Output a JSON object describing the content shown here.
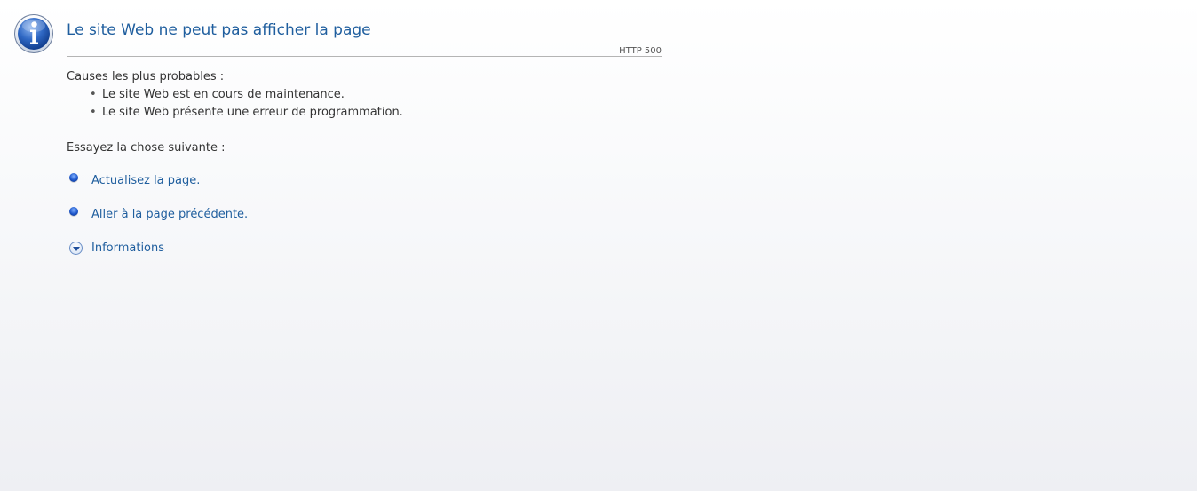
{
  "header": {
    "title": "Le site Web ne peut pas afficher la page",
    "http_code": "HTTP 500",
    "icon": "info-icon"
  },
  "causes": {
    "heading": "Causes les plus probables :",
    "items": [
      "Le site Web est en cours de maintenance.",
      "Le site Web présente une erreur de programmation."
    ]
  },
  "try": {
    "heading": "Essayez la chose suivante :",
    "actions": [
      {
        "label": "Actualisez la page.",
        "icon": "blue-bullet-icon"
      },
      {
        "label": "Aller à la page précédente.",
        "icon": "blue-bullet-icon"
      },
      {
        "label": "Informations",
        "icon": "chevron-down-icon"
      }
    ]
  },
  "colors": {
    "link": "#1f5e9e",
    "text": "#333333",
    "rule": "#b4b4b4",
    "icon_blue": "#1c55c9"
  }
}
